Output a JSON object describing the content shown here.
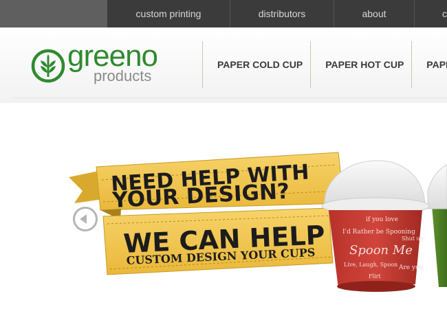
{
  "top_nav": {
    "items": [
      "custom printing",
      "distributors",
      "about",
      "c"
    ]
  },
  "logo": {
    "word1": "greeno",
    "word2": "products"
  },
  "main_nav": {
    "items": [
      "PAPER COLD CUP",
      "PAPER HOT CUP",
      "PAPE"
    ]
  },
  "banner": {
    "line1": "NEED HELP WITH",
    "line2": "YOUR DESIGN?",
    "line3": "WE CAN HELP",
    "line4": "CUSTOM DESIGN YOUR CUPS"
  },
  "cup": {
    "texts": [
      "I'd Rather be Spooning",
      "Spoon Me",
      "Live, Laugh, Spoon",
      "if you love",
      "Shut up",
      "Are you",
      "Flirt"
    ]
  },
  "colors": {
    "brand_green": "#2f8a2f",
    "banner_yellow": "#f2c94c",
    "cup_red": "#c0392b"
  }
}
